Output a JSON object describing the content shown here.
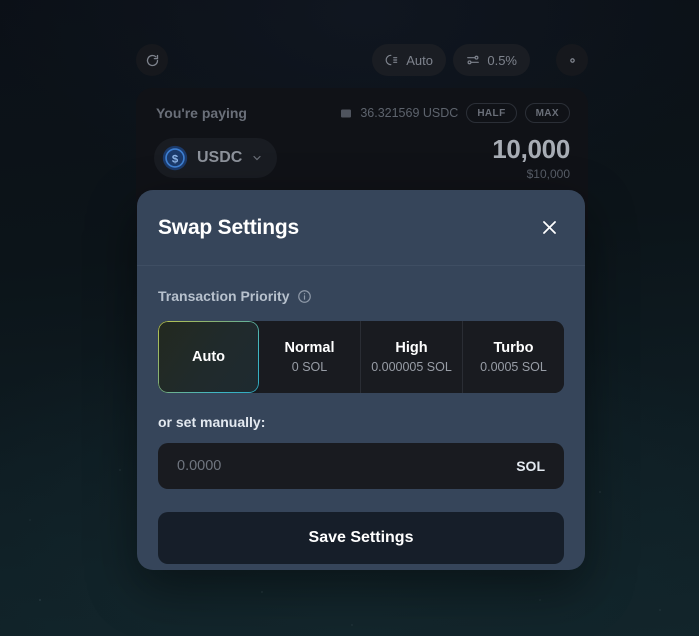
{
  "colors": {
    "modal_bg": "#36455a",
    "page_bg": "#0c1418",
    "accent_gradient_start": "#b9c44e",
    "accent_gradient_end": "#2ea9c0",
    "card_bg": "#101217",
    "segment_bg": "#191b20",
    "save_button_bg": "#161e29"
  },
  "background_app": {
    "toolbar": {
      "refresh_icon": "refresh-icon",
      "priority_pill": {
        "icon": "priority-fee-icon",
        "label": "Auto"
      },
      "slippage_pill": {
        "icon": "slippage-sliders-icon",
        "label": "0.5%"
      },
      "settings_icon": "gear-icon"
    },
    "swap_card": {
      "pay_label": "You're paying",
      "wallet_icon": "wallet-icon",
      "balance": "36.321569 USDC",
      "half_label": "HALF",
      "max_label": "MAX",
      "token": {
        "symbol": "USDC",
        "logo": "usdc-token-icon",
        "chevron": "chevron-down-icon"
      },
      "amount": "10,000",
      "amount_usd": "$10,000"
    }
  },
  "modal": {
    "title": "Swap Settings",
    "close_icon": "close-icon",
    "section": {
      "label": "Transaction Priority",
      "info_icon": "info-icon"
    },
    "priority_options": [
      {
        "title": "Auto",
        "sub": "",
        "selected": true
      },
      {
        "title": "Normal",
        "sub": "0 SOL",
        "selected": false
      },
      {
        "title": "High",
        "sub": "0.000005 SOL",
        "selected": false
      },
      {
        "title": "Turbo",
        "sub": "0.0005 SOL",
        "selected": false
      }
    ],
    "manual": {
      "label": "or set manually:",
      "value": "",
      "placeholder": "0.0000",
      "unit": "SOL"
    },
    "save_label": "Save Settings"
  }
}
